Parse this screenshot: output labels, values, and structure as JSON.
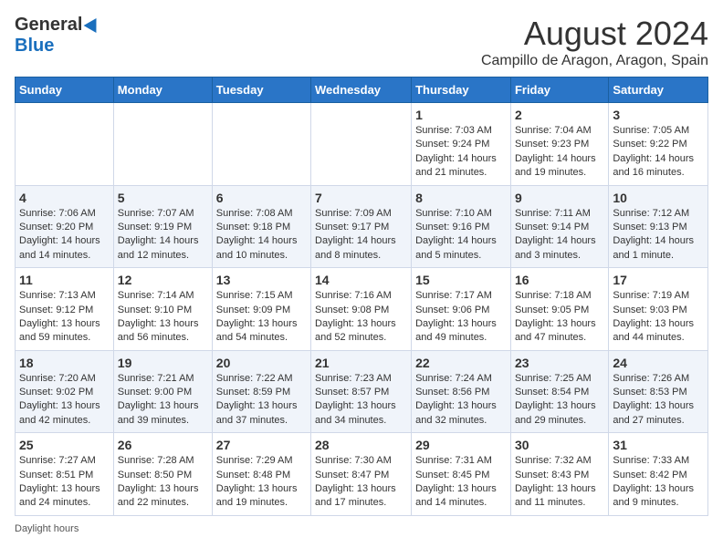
{
  "logo": {
    "general": "General",
    "blue": "Blue"
  },
  "title": "August 2024",
  "location": "Campillo de Aragon, Aragon, Spain",
  "days_of_week": [
    "Sunday",
    "Monday",
    "Tuesday",
    "Wednesday",
    "Thursday",
    "Friday",
    "Saturday"
  ],
  "weeks": [
    [
      {
        "day": "",
        "info": ""
      },
      {
        "day": "",
        "info": ""
      },
      {
        "day": "",
        "info": ""
      },
      {
        "day": "",
        "info": ""
      },
      {
        "day": "1",
        "info": "Sunrise: 7:03 AM\nSunset: 9:24 PM\nDaylight: 14 hours and 21 minutes."
      },
      {
        "day": "2",
        "info": "Sunrise: 7:04 AM\nSunset: 9:23 PM\nDaylight: 14 hours and 19 minutes."
      },
      {
        "day": "3",
        "info": "Sunrise: 7:05 AM\nSunset: 9:22 PM\nDaylight: 14 hours and 16 minutes."
      }
    ],
    [
      {
        "day": "4",
        "info": "Sunrise: 7:06 AM\nSunset: 9:20 PM\nDaylight: 14 hours and 14 minutes."
      },
      {
        "day": "5",
        "info": "Sunrise: 7:07 AM\nSunset: 9:19 PM\nDaylight: 14 hours and 12 minutes."
      },
      {
        "day": "6",
        "info": "Sunrise: 7:08 AM\nSunset: 9:18 PM\nDaylight: 14 hours and 10 minutes."
      },
      {
        "day": "7",
        "info": "Sunrise: 7:09 AM\nSunset: 9:17 PM\nDaylight: 14 hours and 8 minutes."
      },
      {
        "day": "8",
        "info": "Sunrise: 7:10 AM\nSunset: 9:16 PM\nDaylight: 14 hours and 5 minutes."
      },
      {
        "day": "9",
        "info": "Sunrise: 7:11 AM\nSunset: 9:14 PM\nDaylight: 14 hours and 3 minutes."
      },
      {
        "day": "10",
        "info": "Sunrise: 7:12 AM\nSunset: 9:13 PM\nDaylight: 14 hours and 1 minute."
      }
    ],
    [
      {
        "day": "11",
        "info": "Sunrise: 7:13 AM\nSunset: 9:12 PM\nDaylight: 13 hours and 59 minutes."
      },
      {
        "day": "12",
        "info": "Sunrise: 7:14 AM\nSunset: 9:10 PM\nDaylight: 13 hours and 56 minutes."
      },
      {
        "day": "13",
        "info": "Sunrise: 7:15 AM\nSunset: 9:09 PM\nDaylight: 13 hours and 54 minutes."
      },
      {
        "day": "14",
        "info": "Sunrise: 7:16 AM\nSunset: 9:08 PM\nDaylight: 13 hours and 52 minutes."
      },
      {
        "day": "15",
        "info": "Sunrise: 7:17 AM\nSunset: 9:06 PM\nDaylight: 13 hours and 49 minutes."
      },
      {
        "day": "16",
        "info": "Sunrise: 7:18 AM\nSunset: 9:05 PM\nDaylight: 13 hours and 47 minutes."
      },
      {
        "day": "17",
        "info": "Sunrise: 7:19 AM\nSunset: 9:03 PM\nDaylight: 13 hours and 44 minutes."
      }
    ],
    [
      {
        "day": "18",
        "info": "Sunrise: 7:20 AM\nSunset: 9:02 PM\nDaylight: 13 hours and 42 minutes."
      },
      {
        "day": "19",
        "info": "Sunrise: 7:21 AM\nSunset: 9:00 PM\nDaylight: 13 hours and 39 minutes."
      },
      {
        "day": "20",
        "info": "Sunrise: 7:22 AM\nSunset: 8:59 PM\nDaylight: 13 hours and 37 minutes."
      },
      {
        "day": "21",
        "info": "Sunrise: 7:23 AM\nSunset: 8:57 PM\nDaylight: 13 hours and 34 minutes."
      },
      {
        "day": "22",
        "info": "Sunrise: 7:24 AM\nSunset: 8:56 PM\nDaylight: 13 hours and 32 minutes."
      },
      {
        "day": "23",
        "info": "Sunrise: 7:25 AM\nSunset: 8:54 PM\nDaylight: 13 hours and 29 minutes."
      },
      {
        "day": "24",
        "info": "Sunrise: 7:26 AM\nSunset: 8:53 PM\nDaylight: 13 hours and 27 minutes."
      }
    ],
    [
      {
        "day": "25",
        "info": "Sunrise: 7:27 AM\nSunset: 8:51 PM\nDaylight: 13 hours and 24 minutes."
      },
      {
        "day": "26",
        "info": "Sunrise: 7:28 AM\nSunset: 8:50 PM\nDaylight: 13 hours and 22 minutes."
      },
      {
        "day": "27",
        "info": "Sunrise: 7:29 AM\nSunset: 8:48 PM\nDaylight: 13 hours and 19 minutes."
      },
      {
        "day": "28",
        "info": "Sunrise: 7:30 AM\nSunset: 8:47 PM\nDaylight: 13 hours and 17 minutes."
      },
      {
        "day": "29",
        "info": "Sunrise: 7:31 AM\nSunset: 8:45 PM\nDaylight: 13 hours and 14 minutes."
      },
      {
        "day": "30",
        "info": "Sunrise: 7:32 AM\nSunset: 8:43 PM\nDaylight: 13 hours and 11 minutes."
      },
      {
        "day": "31",
        "info": "Sunrise: 7:33 AM\nSunset: 8:42 PM\nDaylight: 13 hours and 9 minutes."
      }
    ]
  ],
  "footer": {
    "daylight_label": "Daylight hours"
  }
}
